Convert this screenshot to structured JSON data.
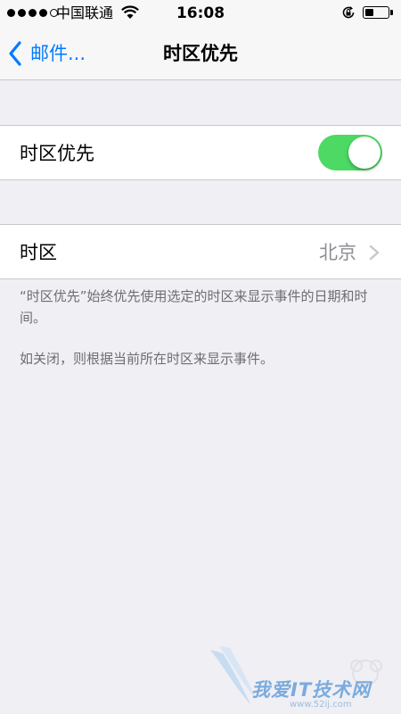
{
  "status_bar": {
    "carrier": "中国联通",
    "time": "16:08",
    "battery_level": 0.4,
    "signal_strength": 4,
    "signal_max": 5
  },
  "nav": {
    "back_label": "邮件...",
    "title": "时区优先"
  },
  "settings": {
    "override": {
      "label": "时区优先",
      "enabled": true
    },
    "timezone": {
      "label": "时区",
      "value": "北京"
    },
    "footer_lines": [
      "“时区优先”始终优先使用选定的时区来显示事件的日期和时间。",
      "如关闭，则根据当前所在时区来显示事件。"
    ]
  },
  "watermark": {
    "text": "我爱IT技术网",
    "url": "www.52ij.com"
  },
  "colors": {
    "accent": "#007aff",
    "toggle_on": "#4cd964",
    "background": "#efeff4",
    "secondary_text": "#8e8e93"
  }
}
